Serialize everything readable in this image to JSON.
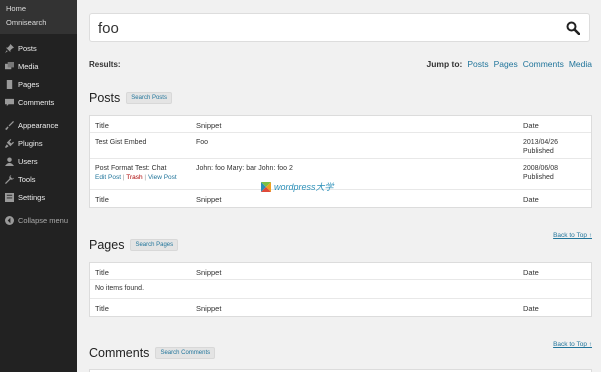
{
  "sidebar": {
    "top_links": [
      "Home",
      "Omnisearch"
    ],
    "items": [
      {
        "label": "Posts",
        "icon": "pin-icon"
      },
      {
        "label": "Media",
        "icon": "media-icon"
      },
      {
        "label": "Pages",
        "icon": "pages-icon"
      },
      {
        "label": "Comments",
        "icon": "comments-icon"
      },
      {
        "label": "Appearance",
        "icon": "brush-icon"
      },
      {
        "label": "Plugins",
        "icon": "plug-icon"
      },
      {
        "label": "Users",
        "icon": "users-icon"
      },
      {
        "label": "Tools",
        "icon": "wrench-icon"
      },
      {
        "label": "Settings",
        "icon": "settings-icon"
      },
      {
        "label": "Collapse menu",
        "icon": "collapse-icon"
      }
    ]
  },
  "search": {
    "value": "foo"
  },
  "results_label": "Results:",
  "jump": {
    "label": "Jump to:",
    "links": [
      "Posts",
      "Pages",
      "Comments",
      "Media"
    ]
  },
  "posts": {
    "title": "Posts",
    "button": "Search Posts",
    "columns": [
      "Title",
      "Snippet",
      "Date"
    ],
    "rows": [
      {
        "title": "Test Gist Embed",
        "snippet": "Foo",
        "date": "2013/04/26",
        "status": "Published"
      },
      {
        "title": "Post Format Test: Chat",
        "snippet": "John: foo Mary: bar John: foo 2",
        "date": "2008/06/08",
        "status": "Published",
        "actions": {
          "edit": "Edit Post",
          "sep": "|",
          "trash": "Trash",
          "view": "View Post"
        }
      }
    ]
  },
  "pages": {
    "title": "Pages",
    "button": "Search Pages",
    "columns": [
      "Title",
      "Snippet",
      "Date"
    ],
    "empty": "No items found."
  },
  "comments": {
    "title": "Comments",
    "button": "Search Comments"
  },
  "back_to_top": "Back to Top ↑",
  "watermark": "wordpress大学",
  "colors": {
    "link": "#21759b",
    "sidebar": "#222222",
    "trash": "#aa0000"
  }
}
